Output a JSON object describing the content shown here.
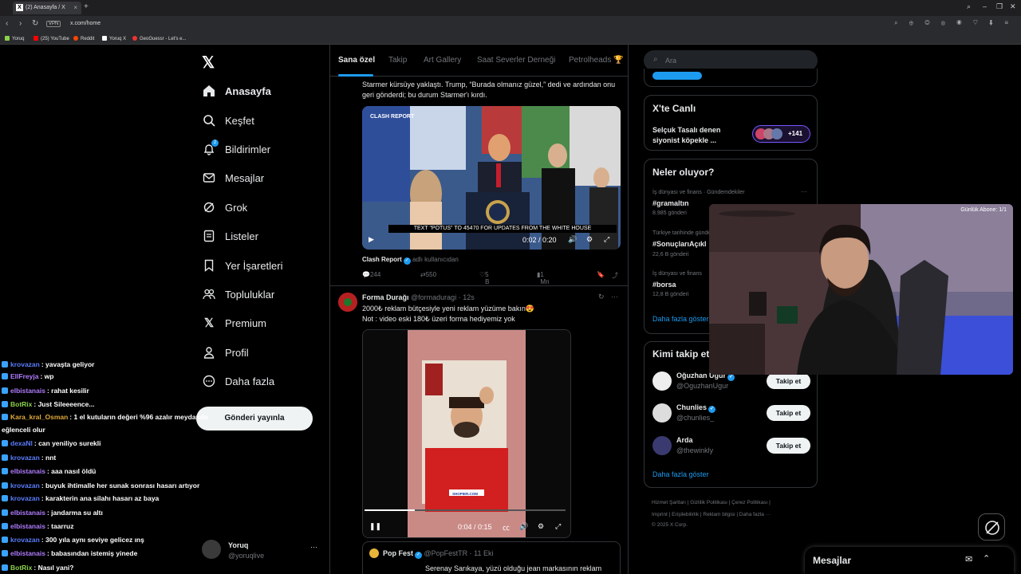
{
  "browser": {
    "tab_title": "(2) Anasayfa / X",
    "url": "x.com/home",
    "vpn": "VPN",
    "bookmarks": [
      "Yoruq",
      "(25) YouTube",
      "Reddit",
      "Yoruq X",
      "GeoGuessr - Let's e..."
    ]
  },
  "nav": {
    "items": [
      {
        "label": "Anasayfa",
        "icon": "home-icon"
      },
      {
        "label": "Keşfet",
        "icon": "search-icon"
      },
      {
        "label": "Bildirimler",
        "icon": "bell-icon",
        "badge": "2"
      },
      {
        "label": "Mesajlar",
        "icon": "mail-icon"
      },
      {
        "label": "Grok",
        "icon": "grok-icon"
      },
      {
        "label": "Listeler",
        "icon": "list-icon"
      },
      {
        "label": "Yer İşaretleri",
        "icon": "bookmark-icon"
      },
      {
        "label": "Topluluklar",
        "icon": "people-icon"
      },
      {
        "label": "Premium",
        "icon": "x-icon"
      },
      {
        "label": "Profil",
        "icon": "person-icon"
      },
      {
        "label": "Daha fazla",
        "icon": "more-circle-icon"
      }
    ],
    "post_button": "Gönderi yayınla",
    "profile_name": "Yoruq",
    "profile_handle": "@yoruqlive",
    "profile_more": "···"
  },
  "chat": [
    {
      "user": "krovazan",
      "msg": ": yavaşta geliyor",
      "color": "#5b7cfa"
    },
    {
      "user": "EllFreyja",
      "msg": ": wp",
      "color": "#b07cff"
    },
    {
      "user": "elbistanais",
      "msg": ": rahat kesilir",
      "color": "#b07cff"
    },
    {
      "user": "BotRix",
      "msg": ": Just Sileeeence...",
      "color": "#8bd24a"
    },
    {
      "user": "Kara_kral_Osman",
      "msg": ": 1 el kutuların değeri %96 azalır meydanda",
      "color": "#e0a93a"
    },
    {
      "user": "",
      "msg": "eğlenceli olur",
      "color": "#fff"
    },
    {
      "user": "dexaNl",
      "msg": ": can yeniliyo surekli",
      "color": "#5b7cfa"
    },
    {
      "user": "krovazan",
      "msg": ": nnt",
      "color": "#5b7cfa"
    },
    {
      "user": "elbistanais",
      "msg": ": aaa nasıl öldü",
      "color": "#b07cff"
    },
    {
      "user": "krovazan",
      "msg": ": buyuk ihtimalle her sunak sonrası hasarı artıyor",
      "color": "#5b7cfa"
    },
    {
      "user": "krovazan",
      "msg": ": karakterin ana silahı hasarı az baya",
      "color": "#5b7cfa"
    },
    {
      "user": "elbistanais",
      "msg": ": jandarma su altı",
      "color": "#b07cff"
    },
    {
      "user": "elbistanais",
      "msg": ": taarruz",
      "color": "#b07cff"
    },
    {
      "user": "krovazan",
      "msg": ": 300 yıla aynı seviye gelicez ınş",
      "color": "#5b7cfa"
    },
    {
      "user": "elbistanais",
      "msg": ": babasından istemiş yinede",
      "color": "#b07cff"
    },
    {
      "user": "BotRix",
      "msg": ": Nasıl yani?",
      "color": "#8bd24a"
    }
  ],
  "feed": {
    "tabs": [
      "Sana özel",
      "Takip",
      "Art Gallery",
      "Saat Severler Derneği",
      "Petrolheads 🏆"
    ],
    "tweet1": {
      "text": "Starmer kürsüye yaklaştı. Trump, “Burada olmanız güzel,” dedi ve ardından onu geri gönderdi; bu durum Starmer'ı kırdı.",
      "caption": "TEXT \"POTUS\" TO 45470 FOR UPDATES FROM THE WHITE HOUSE",
      "watermark": "CLASH REPORT",
      "time": "0:02 / 0:20",
      "source_name": "Clash Report",
      "source_suffix": "adlı kullanıcıdan",
      "replies": "244",
      "retweets": "550",
      "likes": "5 B",
      "views": "1 Mn"
    },
    "tweet2": {
      "name": "Forma Durağı",
      "handle": "@formaduragi · 12s",
      "line1": "2000₺ reklam bütçesiyle yeni reklam yüzüme bakın😍",
      "line2": "Not : video eski 180₺ üzeri forma hediyemiz yok",
      "time": "0:04 / 0:15",
      "shirt_text": "SHOPIER.COM"
    },
    "quote": {
      "name": "Pop Fest",
      "handle": "@PopFestTR · 11 Eki",
      "text": "Serenay Sarıkaya, yüzü olduğu jean markasının reklam"
    }
  },
  "right": {
    "search_placeholder": "Ara",
    "live_title": "X'te Canlı",
    "live_text": "Selçuk Tasalı denen siyonist köpekle ...",
    "live_count": "+141",
    "trends_title": "Neler oluyor?",
    "trends": [
      {
        "cat": "İş dünyası ve finans · Gündemdekiler",
        "tag": "#gramaltın",
        "count": "8.985 gönderi"
      },
      {
        "cat": "Türkiye tarihinde gündemde",
        "tag": "#SonuçlarıAçıkl",
        "count": "22,6 B gönderi"
      },
      {
        "cat": "İş dünyası ve finans",
        "tag": "#borsa",
        "count": "12,8 B gönderi"
      }
    ],
    "show_more": "Daha fazla göster",
    "follow_title": "Kimi takip et",
    "follow": [
      {
        "name": "Oğuzhan Uğur",
        "handle": "@OguzhanUgur",
        "verified": true
      },
      {
        "name": "Chunlies",
        "handle": "@chunlies_",
        "verified": true
      },
      {
        "name": "Arda",
        "handle": "@thewinkly",
        "verified": false
      }
    ],
    "follow_button": "Takip et",
    "footer1": "Hizmet Şartları  |  Gizlilik Politikası  |  Çerez Politikası  |",
    "footer2": "Imprint  |  Erişilebilirlik  |  Reklam bilgisi  |  Daha fazla ···",
    "footer3": "© 2025 X Corp.",
    "cam_label": "Günlük Abone: 1/1",
    "dock_label": "Mesajlar"
  }
}
